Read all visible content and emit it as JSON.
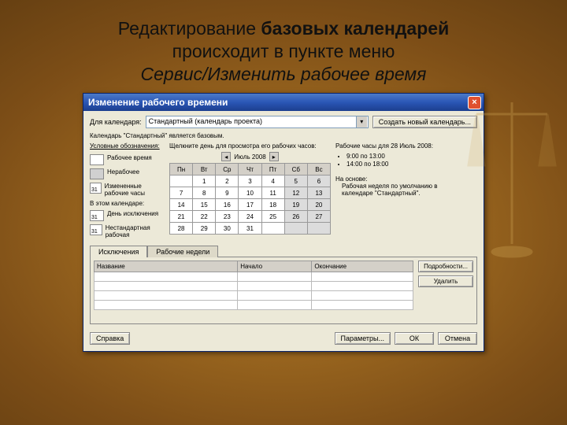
{
  "heading": {
    "l1a": "Редактирование ",
    "l1b": "базовых календарей",
    "l2": "происходит в пункте меню",
    "l3": "Сервис/Изменить рабочее время"
  },
  "dialog": {
    "title": "Изменение рабочего времени",
    "calendar_label": "Для календаря:",
    "calendar_value": "Стандартный (календарь проекта)",
    "new_cal_btn": "Создать новый календарь...",
    "base_note": "Календарь \"Стандартный\" является базовым.",
    "legend_title": "Условные обозначения:",
    "legend": {
      "work": "Рабочее время",
      "nonwork": "Нерабочее",
      "changed": "Измененные рабочие часы",
      "in_this": "В этом календаре:",
      "exc_day": "День исключения",
      "nonstd": "Нестандартная рабочая"
    },
    "cal_hint": "Щелкните день для просмотра его рабочих часов:",
    "month": "Июль 2008",
    "dow": [
      "Пн",
      "Вт",
      "Ср",
      "Чт",
      "Пт",
      "Сб",
      "Вс"
    ],
    "weeks": [
      [
        "",
        "1",
        "2",
        "3",
        "4",
        "5",
        "6"
      ],
      [
        "7",
        "8",
        "9",
        "10",
        "11",
        "12",
        "13"
      ],
      [
        "14",
        "15",
        "16",
        "17",
        "18",
        "19",
        "20"
      ],
      [
        "21",
        "22",
        "23",
        "24",
        "25",
        "26",
        "27"
      ],
      [
        "28",
        "29",
        "30",
        "31",
        "",
        "",
        ""
      ]
    ],
    "details": {
      "title": "Рабочие часы для 28 Июль 2008:",
      "h1": "9:00 по 13:00",
      "h2": "14:00 по 18:00",
      "base_lbl": "На основе:",
      "base_txt": "Рабочая неделя по умолчанию в календаре \"Стандартный\"."
    },
    "tabs": {
      "exc": "Исключения",
      "ww": "Рабочие недели"
    },
    "grid": {
      "name": "Название",
      "start": "Начало",
      "end": "Окончание"
    },
    "side": {
      "details": "Подробности...",
      "delete": "Удалить"
    },
    "footer": {
      "help": "Справка",
      "params": "Параметры...",
      "ok": "ОК",
      "cancel": "Отмена"
    }
  }
}
